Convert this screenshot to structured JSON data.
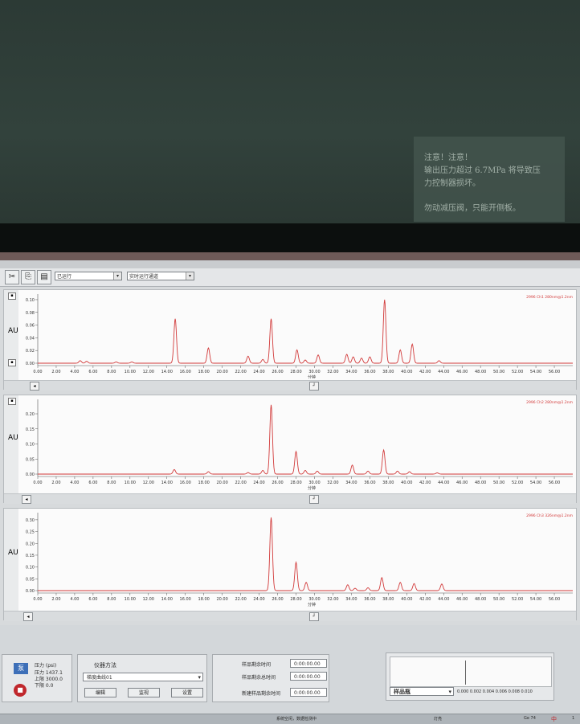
{
  "notice": {
    "line1": "注意！注意！",
    "line2": "输出压力超过 6.7MPa 将导致压",
    "line3": "力控制器损坏。",
    "line4": "勿动减压阀，只能开侧板。"
  },
  "toolbar": {
    "cut_icon": "✂",
    "copy_icon": "⎘",
    "paste_icon": "▤",
    "combo1_value": "已运行",
    "combo2_value": "实时运行通道"
  },
  "axis": {
    "xlabel": "分钟",
    "xticks": [
      "0.00",
      "2.00",
      "4.00",
      "6.00",
      "8.00",
      "10.00",
      "12.00",
      "14.00",
      "16.00",
      "18.00",
      "20.00",
      "22.00",
      "24.00",
      "26.00",
      "28.00",
      "30.00",
      "32.00",
      "34.00",
      "36.00",
      "38.00",
      "40.00",
      "42.00",
      "44.00",
      "46.00",
      "48.00",
      "50.00",
      "52.00",
      "54.00",
      "56.00"
    ]
  },
  "panels": [
    {
      "legend": "2996 Ch1 280nm@1.2nm",
      "ylabel": "AU",
      "yticks": [
        "0.10",
        "0.08",
        "0.06",
        "0.04",
        "0.02",
        "0.00"
      ]
    },
    {
      "legend": "2996 Ch2 280nm@1.2nm",
      "ylabel": "AU",
      "yticks": [
        "0.20",
        "0.15",
        "0.10",
        "0.05",
        "0.00"
      ]
    },
    {
      "legend": "2996 Ch3 326nm@1.2nm",
      "ylabel": "AU",
      "yticks": [
        "0.30",
        "0.25",
        "0.20",
        "0.15",
        "0.10",
        "0.05",
        "0.00"
      ]
    }
  ],
  "chart_data": [
    {
      "type": "line",
      "title": "2996 Ch1 280nm@1.2nm",
      "xlabel": "分钟",
      "ylabel": "AU",
      "xlim": [
        0,
        58
      ],
      "ylim": [
        -0.005,
        0.105
      ],
      "grid": false,
      "series": [
        {
          "name": "2996 Ch1 280nm@1.2nm",
          "color": "#d23a3a",
          "peaks": [
            [
              4.6,
              0.004
            ],
            [
              5.3,
              0.003
            ],
            [
              8.5,
              0.002
            ],
            [
              10.2,
              0.002
            ],
            [
              14.9,
              0.07
            ],
            [
              18.5,
              0.024
            ],
            [
              22.8,
              0.011
            ],
            [
              24.4,
              0.006
            ],
            [
              25.3,
              0.07
            ],
            [
              28.1,
              0.021
            ],
            [
              29.0,
              0.005
            ],
            [
              30.4,
              0.013
            ],
            [
              33.5,
              0.014
            ],
            [
              34.2,
              0.01
            ],
            [
              35.1,
              0.008
            ],
            [
              36.0,
              0.01
            ],
            [
              37.6,
              0.1
            ],
            [
              39.3,
              0.021
            ],
            [
              40.6,
              0.03
            ],
            [
              43.5,
              0.004
            ]
          ]
        }
      ]
    },
    {
      "type": "line",
      "title": "2996 Ch2 280nm@1.2nm",
      "xlabel": "分钟",
      "ylabel": "AU",
      "xlim": [
        0,
        58
      ],
      "ylim": [
        -0.01,
        0.24
      ],
      "grid": false,
      "series": [
        {
          "name": "2996 Ch2 280nm@1.2nm",
          "color": "#d23a3a",
          "peaks": [
            [
              14.8,
              0.015
            ],
            [
              18.5,
              0.008
            ],
            [
              22.8,
              0.005
            ],
            [
              24.4,
              0.012
            ],
            [
              25.3,
              0.23
            ],
            [
              28.0,
              0.075
            ],
            [
              29.0,
              0.012
            ],
            [
              30.3,
              0.01
            ],
            [
              34.1,
              0.03
            ],
            [
              35.8,
              0.01
            ],
            [
              37.5,
              0.08
            ],
            [
              39.0,
              0.01
            ],
            [
              40.3,
              0.008
            ],
            [
              43.3,
              0.004
            ]
          ]
        }
      ]
    },
    {
      "type": "line",
      "title": "2996 Ch3 326nm@1.2nm",
      "xlabel": "分钟",
      "ylabel": "AU",
      "xlim": [
        0,
        58
      ],
      "ylim": [
        -0.01,
        0.32
      ],
      "grid": false,
      "series": [
        {
          "name": "2996 Ch3 326nm@1.2nm",
          "color": "#d23a3a",
          "peaks": [
            [
              25.3,
              0.31
            ],
            [
              28.0,
              0.12
            ],
            [
              29.1,
              0.035
            ],
            [
              33.6,
              0.025
            ],
            [
              34.4,
              0.01
            ],
            [
              35.8,
              0.012
            ],
            [
              37.3,
              0.055
            ],
            [
              39.3,
              0.035
            ],
            [
              40.8,
              0.03
            ],
            [
              43.8,
              0.028
            ]
          ]
        }
      ]
    }
  ],
  "status": {
    "pressure_label": "压力 (psi)",
    "pressure_value": "压力 1437.1",
    "upper_value": "上限 3000.0",
    "lower_value": "下限 0.0"
  },
  "method": {
    "label": "仪器方法",
    "value": "梯度曲线01",
    "edit_label": "编辑",
    "monitor_label": "监视",
    "setup_label": "设置"
  },
  "timing": {
    "remaining_label": "样品剩余时间",
    "remaining_value": "0:00:00.00",
    "total_label": "样品剩余总时间",
    "total_value": "0:00:00.00",
    "new_label": "新建样品剩余时间",
    "new_value": "0:00:00.00"
  },
  "mini": {
    "combo_value": "样品瓶",
    "ticks": "0.000 0.002 0.004 0.006 0.008 0.010"
  },
  "taskbar": {
    "left_text": "系统空闲，数据检测中",
    "mid_text": "灯亮",
    "right_text": "Ge 74",
    "ime_text": "中",
    "clock": "1"
  }
}
